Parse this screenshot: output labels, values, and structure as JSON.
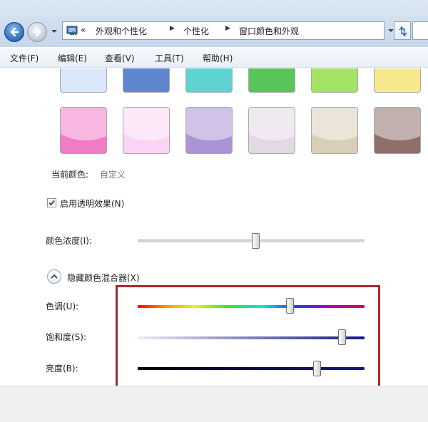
{
  "breadcrumb": {
    "overflow": "«",
    "items": [
      "外观和个性化",
      "个性化",
      "窗口颜色和外观"
    ]
  },
  "menu": [
    "文件(F)",
    "编辑(E)",
    "查看(V)",
    "工具(T)",
    "帮助(H)"
  ],
  "swatches_top_row": [
    "#dbe8fb",
    "#5e86cf",
    "#5fd3d1",
    "#58c45a",
    "#a4e264",
    "#f6e88c"
  ],
  "swatches_bottom_row": [
    "#f07cc6",
    "#fad5f3",
    "#ac93d3",
    "#e3d8e6",
    "#d9cfb8",
    "#8e6f6a"
  ],
  "current_color": {
    "label": "当前颜色:",
    "value": "自定义"
  },
  "transparency": {
    "label": "启用透明效果(N)",
    "checked": true
  },
  "color_intensity": {
    "label": "颜色浓度(I):",
    "value_fraction": 0.52
  },
  "mixer_toggle": {
    "label": "隐藏颜色混合器(X)"
  },
  "mixer": {
    "hue": {
      "label": "色调(U):",
      "value_fraction": 0.67
    },
    "saturation": {
      "label": "饱和度(S):",
      "value_fraction": 0.9
    },
    "brightness": {
      "label": "亮度(B):",
      "value_fraction": 0.79
    }
  },
  "colors": {
    "highlight_border": "#a52a2a",
    "saturation_end": "#16168f",
    "brightness_end": "#16168f"
  }
}
